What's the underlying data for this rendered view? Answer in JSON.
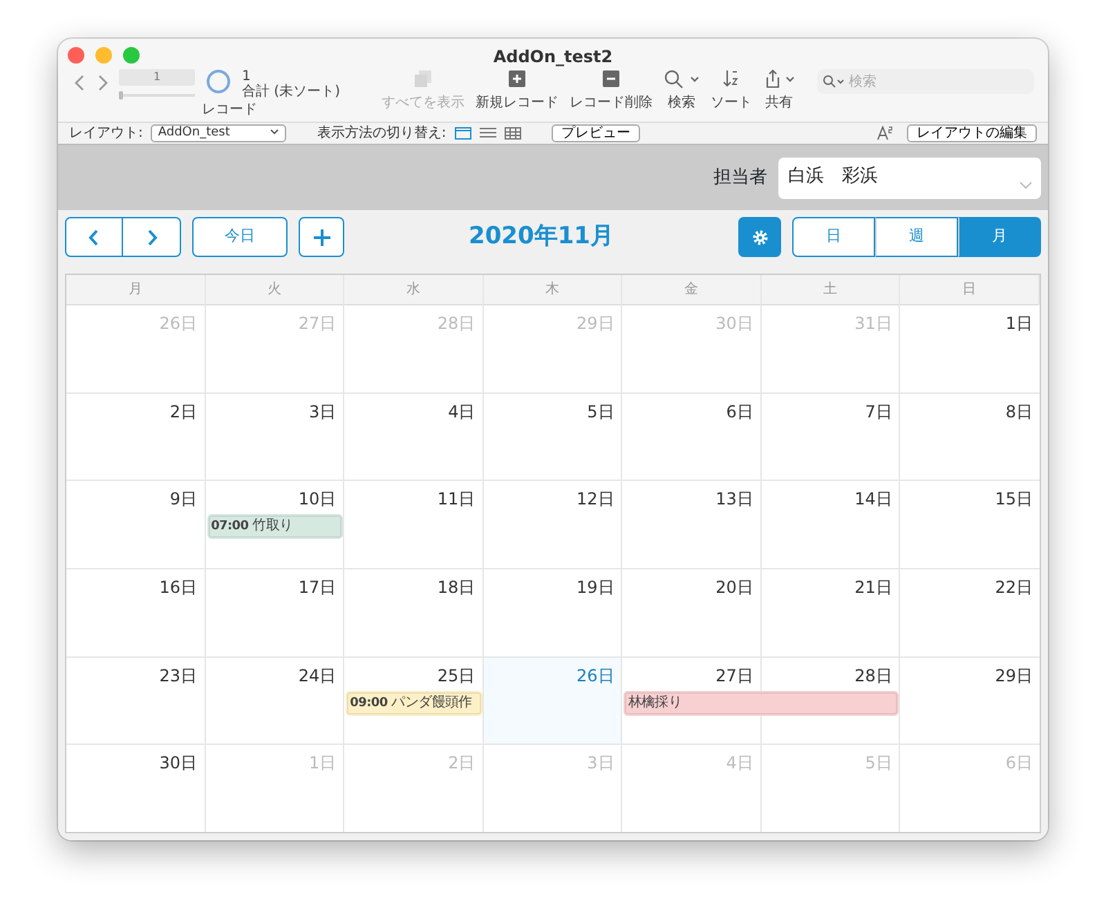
{
  "window": {
    "title": "AddOn_test2"
  },
  "toolbar": {
    "record_current": "1",
    "record_total": "1",
    "record_sort": "合計 (未ソート)",
    "record_label": "レコード",
    "record_slider": {
      "level": 0
    },
    "tools": [
      {
        "kind": "showall",
        "label": "すべてを表示",
        "disabled": true
      },
      {
        "kind": "new",
        "label": "新規レコード",
        "disabled": false
      },
      {
        "kind": "delete",
        "label": "レコード削除",
        "disabled": false
      },
      {
        "kind": "find",
        "label": "検索",
        "disabled": false
      },
      {
        "kind": "sort",
        "label": "ソート",
        "disabled": false
      },
      {
        "kind": "share",
        "label": "共有",
        "disabled": false
      }
    ],
    "search": {
      "placeholder": "検索"
    }
  },
  "layout_bar": {
    "layout_label": "レイアウト:",
    "layout_value": "AddOn_test",
    "view_label": "表示方法の切り替え:",
    "views": [
      {
        "kind": "form",
        "selected": true
      },
      {
        "kind": "list",
        "selected": false
      },
      {
        "kind": "table",
        "selected": false
      }
    ],
    "preview": "プレビュー",
    "edit_layout": "レイアウトの編集"
  },
  "header": {
    "field_label": "担当者",
    "field_value": "白浜　彩浜"
  },
  "calendar": {
    "today_button": "今日",
    "title": "2020年11月",
    "view_tabs": [
      {
        "label": "日",
        "selected": false
      },
      {
        "label": "週",
        "selected": false
      },
      {
        "label": "月",
        "selected": true
      }
    ],
    "weekdays": [
      "月",
      "火",
      "水",
      "木",
      "金",
      "土",
      "日"
    ],
    "weeks": [
      [
        {
          "day": "26日",
          "other_month": true,
          "today": false
        },
        {
          "day": "27日",
          "other_month": true,
          "today": false
        },
        {
          "day": "28日",
          "other_month": true,
          "today": false
        },
        {
          "day": "29日",
          "other_month": true,
          "today": false
        },
        {
          "day": "30日",
          "other_month": true,
          "today": false
        },
        {
          "day": "31日",
          "other_month": true,
          "today": false
        },
        {
          "day": "1日",
          "other_month": false,
          "today": false
        }
      ],
      [
        {
          "day": "2日",
          "other_month": false,
          "today": false
        },
        {
          "day": "3日",
          "other_month": false,
          "today": false
        },
        {
          "day": "4日",
          "other_month": false,
          "today": false
        },
        {
          "day": "5日",
          "other_month": false,
          "today": false
        },
        {
          "day": "6日",
          "other_month": false,
          "today": false
        },
        {
          "day": "7日",
          "other_month": false,
          "today": false
        },
        {
          "day": "8日",
          "other_month": false,
          "today": false
        }
      ],
      [
        {
          "day": "9日",
          "other_month": false,
          "today": false
        },
        {
          "day": "10日",
          "other_month": false,
          "today": false,
          "events": [
            {
              "kind": "event",
              "label": "**07:00** 竹取り",
              "color": "#d6e9e1"
            }
          ]
        },
        {
          "day": "11日",
          "other_month": false,
          "today": false
        },
        {
          "day": "12日",
          "other_month": false,
          "today": false
        },
        {
          "day": "13日",
          "other_month": false,
          "today": false
        },
        {
          "day": "14日",
          "other_month": false,
          "today": false
        },
        {
          "day": "15日",
          "other_month": false,
          "today": false
        }
      ],
      [
        {
          "day": "16日",
          "other_month": false,
          "today": false
        },
        {
          "day": "17日",
          "other_month": false,
          "today": false
        },
        {
          "day": "18日",
          "other_month": false,
          "today": false
        },
        {
          "day": "19日",
          "other_month": false,
          "today": false
        },
        {
          "day": "20日",
          "other_month": false,
          "today": false
        },
        {
          "day": "21日",
          "other_month": false,
          "today": false
        },
        {
          "day": "22日",
          "other_month": false,
          "today": false
        }
      ],
      [
        {
          "day": "23日",
          "other_month": false,
          "today": false
        },
        {
          "day": "24日",
          "other_month": false,
          "today": false
        },
        {
          "day": "25日",
          "other_month": false,
          "today": false,
          "events": [
            {
              "kind": "event",
              "label": "**09:00** パンダ饅頭作",
              "color": "#fdf0c6"
            }
          ]
        },
        {
          "day": "26日",
          "other_month": false,
          "today": true
        },
        {
          "day": "27日",
          "other_month": false,
          "today": false,
          "events": [
            {
              "kind": "event",
              "label": "林檎採り",
              "color": "#f8d0d1"
            }
          ]
        },
        {
          "day": "28日",
          "other_month": false,
          "today": false,
          "events": [
            {
              "kind": "continuation"
            }
          ]
        },
        {
          "day": "29日",
          "other_month": false,
          "today": false
        }
      ],
      [
        {
          "day": "30日",
          "other_month": false,
          "today": false
        },
        {
          "day": "1日",
          "other_month": true,
          "today": false
        },
        {
          "day": "2日",
          "other_month": true,
          "today": false
        },
        {
          "day": "3日",
          "other_month": true,
          "today": false
        },
        {
          "day": "4日",
          "other_month": true,
          "today": false
        },
        {
          "day": "5日",
          "other_month": true,
          "today": false
        },
        {
          "day": "6日",
          "other_month": true,
          "today": false
        }
      ]
    ]
  }
}
